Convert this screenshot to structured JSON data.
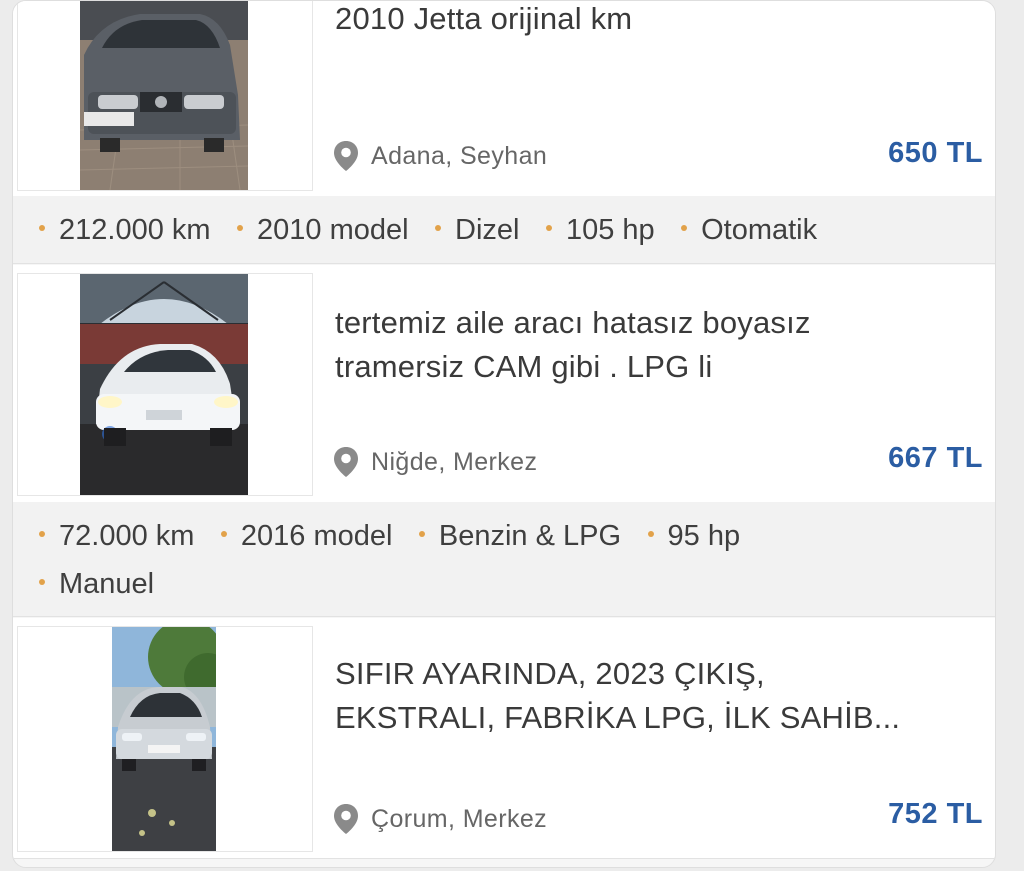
{
  "listings": [
    {
      "title_lines": [
        "2010 Jetta orijinal km"
      ],
      "location": "Adana, Seyhan",
      "price": "650 TL",
      "specs": [
        "212.000 km",
        "2010 model",
        "Dizel",
        "105 hp",
        "Otomatik"
      ],
      "photo": "gray-sedan-photo"
    },
    {
      "title_lines": [
        "tertemiz aile aracı hatasız boyasız",
        "tramersiz CAM gibi . LPG li"
      ],
      "location": "Niğde, Merkez",
      "price": "667 TL",
      "specs": [
        "72.000 km",
        "2016 model",
        "Benzin & LPG",
        "95 hp",
        "Manuel"
      ],
      "photo": "white-sedan-photo"
    },
    {
      "title_lines": [
        "SIFIR AYARINDA, 2023 ÇIKIŞ,",
        "EKSTRALI, FABRİKA LPG, İLK SAHİB..."
      ],
      "location": "Çorum, Merkez",
      "price": "752 TL",
      "photo": "silver-sedan-photo"
    }
  ],
  "colors": {
    "price": "#2b5da3",
    "bullet": "#e2a24a",
    "specs_background": "#f2f2f2"
  },
  "icons": {
    "location": "map-pin-icon",
    "bullet": "dot-bullet-icon"
  }
}
